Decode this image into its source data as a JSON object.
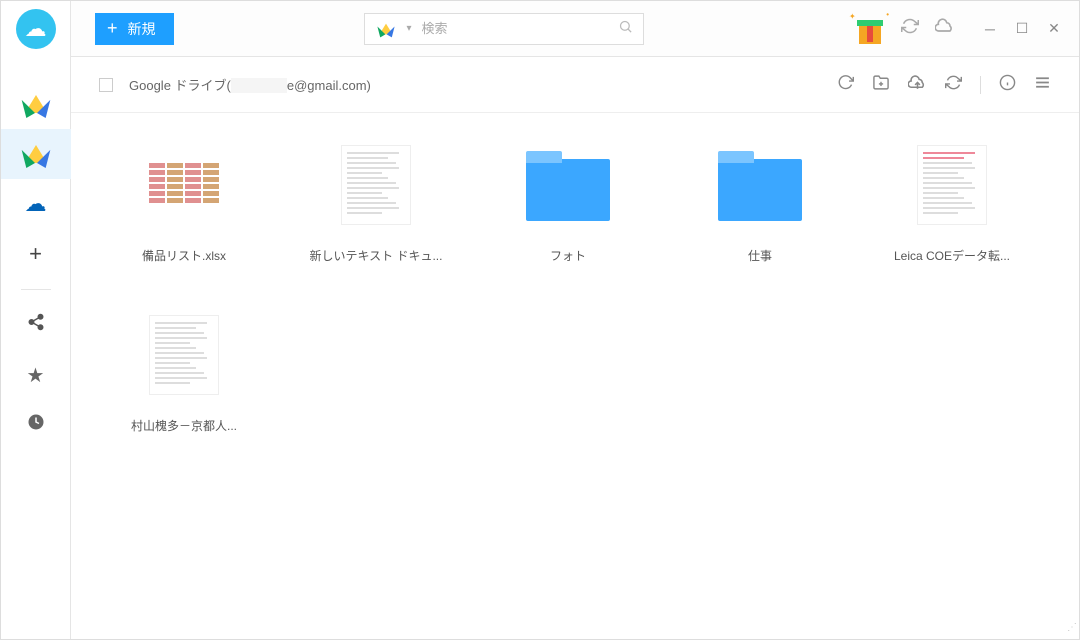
{
  "topbar": {
    "new_button_label": "新規",
    "search_placeholder": "検索"
  },
  "breadcrumb": {
    "account_label": "Google ドライブ(",
    "email_suffix": "e@gmail.com)"
  },
  "files": [
    {
      "name": "備品リスト.xlsx",
      "type": "xls"
    },
    {
      "name": "新しいテキスト ドキュ...",
      "type": "doc"
    },
    {
      "name": "フォト",
      "type": "folder"
    },
    {
      "name": "仕事",
      "type": "folder"
    },
    {
      "name": "Leica COEデータ転...",
      "type": "doc-red"
    },
    {
      "name": "村山槐多－京都人...",
      "type": "doc"
    }
  ]
}
